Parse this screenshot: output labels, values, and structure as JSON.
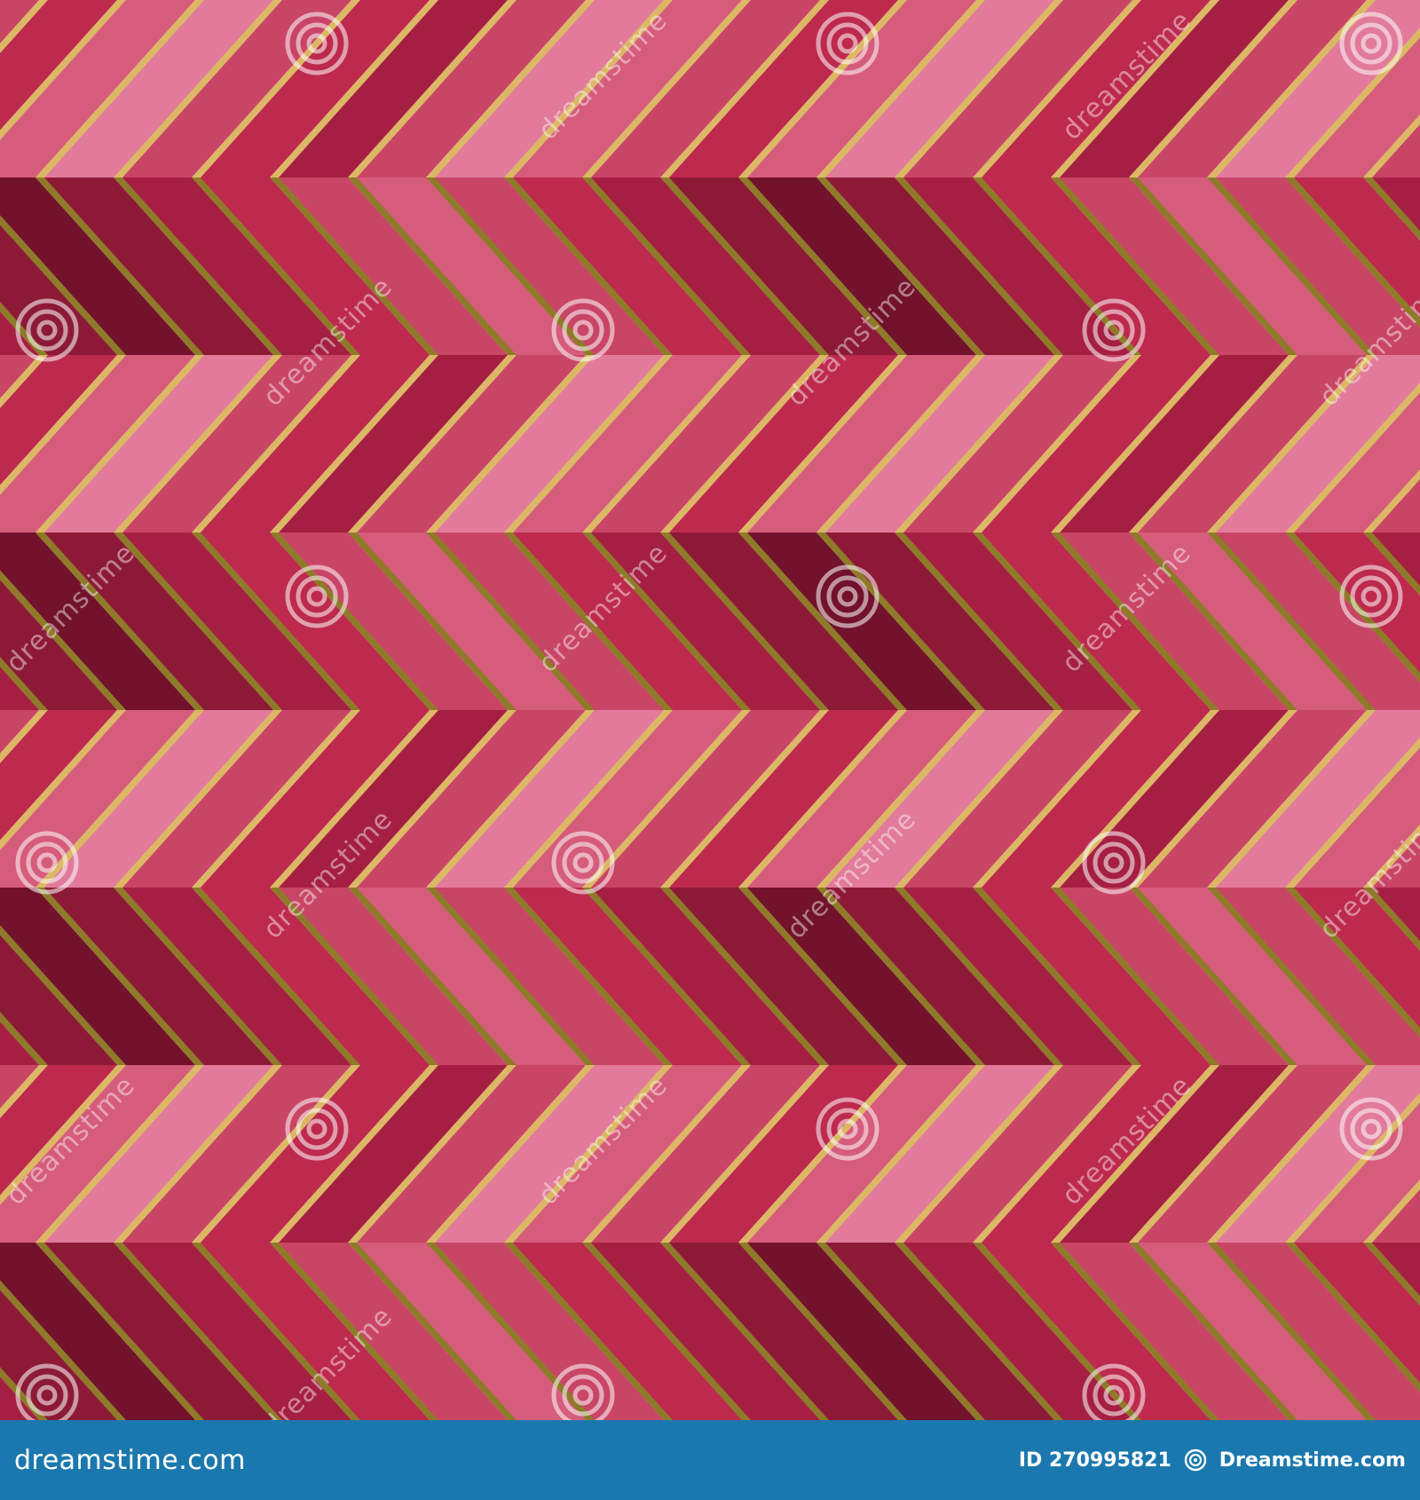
{
  "pattern": {
    "description_colors": {
      "rose_light": "#e27b9b",
      "rose": "#d65c7c",
      "pink": "#c94566",
      "crimson": "#bd2a4e",
      "raspberry": "#a51f42",
      "wine": "#8c1a37",
      "burgundy": "#72122c",
      "gold_light": "#dcb866",
      "gold_dark": "#8f7a2a"
    }
  },
  "watermark": {
    "text": "dreamstime",
    "logo_icon": "spiral-logo-icon"
  },
  "footer": {
    "site": "dreamstime.com",
    "id_text": "ID 270995821",
    "brand": "Dreamstime.com",
    "background": "#1b78ae",
    "logo_icon": "spiral-logo-icon"
  }
}
